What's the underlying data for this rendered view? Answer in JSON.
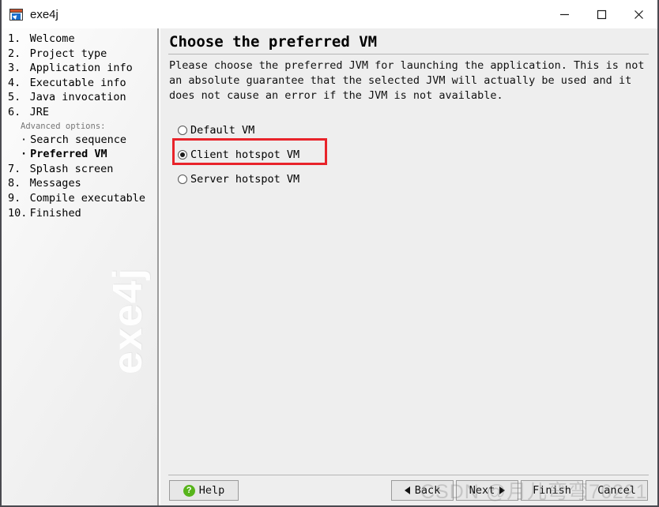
{
  "window": {
    "title": "exe4j",
    "icon": "exe4j-app-icon",
    "controls": {
      "minimize": "minimize-icon",
      "maximize": "maximize-icon",
      "close": "close-icon"
    }
  },
  "sidebar": {
    "watermark": "exe4j",
    "steps": [
      {
        "num": "1.",
        "label": "Welcome",
        "kind": "step",
        "current": false
      },
      {
        "num": "2.",
        "label": "Project type",
        "kind": "step",
        "current": false
      },
      {
        "num": "3.",
        "label": "Application info",
        "kind": "step",
        "current": false
      },
      {
        "num": "4.",
        "label": "Executable info",
        "kind": "step",
        "current": false
      },
      {
        "num": "5.",
        "label": "Java invocation",
        "kind": "step",
        "current": false
      },
      {
        "num": "6.",
        "label": "JRE",
        "kind": "step",
        "current": false
      },
      {
        "num": "",
        "label": "Advanced options:",
        "kind": "group-label",
        "current": false
      },
      {
        "num": "·",
        "label": "Search sequence",
        "kind": "sub",
        "current": false
      },
      {
        "num": "·",
        "label": "Preferred VM",
        "kind": "sub",
        "current": true
      },
      {
        "num": "7.",
        "label": "Splash screen",
        "kind": "step",
        "current": false
      },
      {
        "num": "8.",
        "label": "Messages",
        "kind": "step",
        "current": false
      },
      {
        "num": "9.",
        "label": "Compile executable",
        "kind": "step",
        "current": false
      },
      {
        "num": "10.",
        "label": "Finished",
        "kind": "step",
        "current": false
      }
    ]
  },
  "main": {
    "title": "Choose the preferred VM",
    "description": "Please choose the preferred JVM for launching the application. This is not an absolute guarantee that the selected JVM will actually be used and it does not cause an error if the JVM is not available.",
    "vm_options": [
      {
        "label": "Default VM",
        "selected": false
      },
      {
        "label": "Client hotspot VM",
        "selected": true
      },
      {
        "label": "Server hotspot VM",
        "selected": false
      }
    ],
    "highlight_color": "#e8232a"
  },
  "footer": {
    "help_label": "Help",
    "help_icon": "question-mark-icon",
    "back_label": "Back",
    "next_label": "Next",
    "finish_label": "Finish",
    "cancel_label": "Cancel"
  },
  "overlay": {
    "csdn_watermark": "CSDN @月儿弯弯76221"
  }
}
